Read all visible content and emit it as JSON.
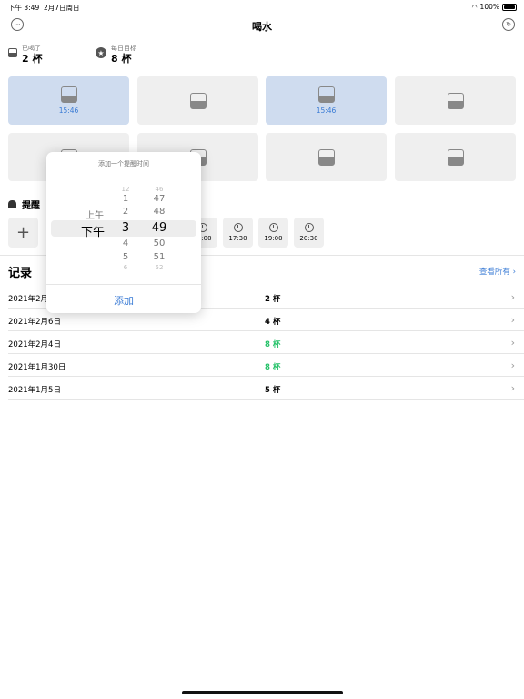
{
  "status": {
    "time": "下午 3:49",
    "date": "2月7日周日",
    "battery": "100%"
  },
  "nav": {
    "title": "喝水"
  },
  "stats": {
    "drank_label": "已喝了",
    "drank_value": "2 杯",
    "goal_label": "每日目标",
    "goal_value": "8 杯"
  },
  "cups": [
    {
      "filled": true,
      "time": "15:46"
    },
    {
      "filled": false,
      "time": ""
    },
    {
      "filled": true,
      "time": "15:46"
    },
    {
      "filled": false,
      "time": ""
    },
    {
      "filled": false,
      "time": ""
    },
    {
      "filled": false,
      "time": ""
    },
    {
      "filled": false,
      "time": ""
    },
    {
      "filled": false,
      "time": ""
    }
  ],
  "reminders": {
    "title": "提醒",
    "add_label": "+",
    "times": [
      "16:00",
      "17:30",
      "19:00",
      "20:30"
    ]
  },
  "popover": {
    "title": "添加一个提醒时间",
    "ampm": [
      "上午",
      "下午"
    ],
    "hours": [
      "12",
      "1",
      "2",
      "3",
      "4",
      "5",
      "6"
    ],
    "minutes": [
      "46",
      "47",
      "48",
      "49",
      "50",
      "51",
      "52"
    ],
    "add_button": "添加"
  },
  "records": {
    "title": "记录",
    "see_all": "查看所有",
    "rows": [
      {
        "date": "2021年2月7日",
        "amount": "2 杯",
        "goal_met": false
      },
      {
        "date": "2021年2月6日",
        "amount": "4 杯",
        "goal_met": false
      },
      {
        "date": "2021年2月4日",
        "amount": "8 杯",
        "goal_met": true
      },
      {
        "date": "2021年1月30日",
        "amount": "8 杯",
        "goal_met": true
      },
      {
        "date": "2021年1月5日",
        "amount": "5 杯",
        "goal_met": false
      }
    ]
  }
}
